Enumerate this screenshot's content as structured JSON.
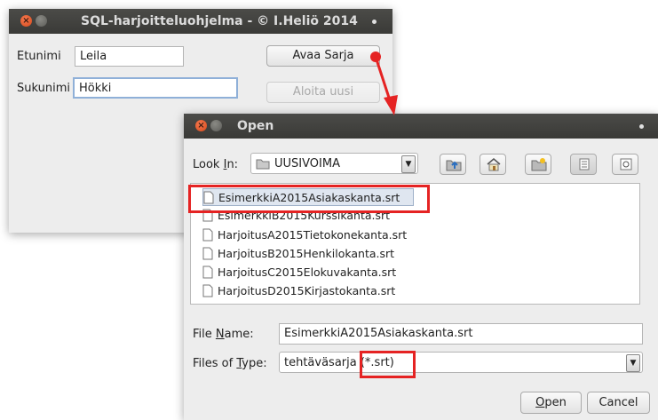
{
  "main_window": {
    "title": "SQL-harjoitteluohjelma - © I.Heliö 2014",
    "firstname_label": "Etunimi",
    "firstname_value": "Leila",
    "lastname_label": "Sukunimi",
    "lastname_value": "Hökki",
    "open_series_button": "Avaa Sarja",
    "restart_button": "Aloita uusi"
  },
  "open_dialog": {
    "title": "Open",
    "look_in_label_pre": "Look ",
    "look_in_label_u": "I",
    "look_in_label_post": "n:",
    "look_in_value": "UUSIVOIMA",
    "toolbar_icons": [
      "up-folder-icon",
      "home-icon",
      "new-folder-icon",
      "list-view-icon",
      "details-view-icon"
    ],
    "files": [
      "EsimerkkiA2015Asiakaskanta.srt",
      "EsimerkkiB2015Kurssikanta.srt",
      "HarjoitusA2015Tietokonekanta.srt",
      "HarjoitusB2015Henkilokanta.srt",
      "HarjoitusC2015Elokuvakanta.srt",
      "HarjoitusD2015Kirjastokanta.srt"
    ],
    "selected_index": 0,
    "file_name_label_pre": "File ",
    "file_name_label_u": "N",
    "file_name_label_post": "ame:",
    "file_name_value": "EsimerkkiA2015Asiakaskanta.srt",
    "files_of_type_label_pre": "Files of ",
    "files_of_type_label_u": "T",
    "files_of_type_label_post": "ype:",
    "files_of_type_value": "tehtäväsarja (*.srt)",
    "open_button_u": "O",
    "open_button_rest": "pen",
    "cancel_button": "Cancel"
  },
  "colors": {
    "annotation_red": "#e52323",
    "titlebar": "#3c3b37",
    "close_button": "#e8592a"
  }
}
